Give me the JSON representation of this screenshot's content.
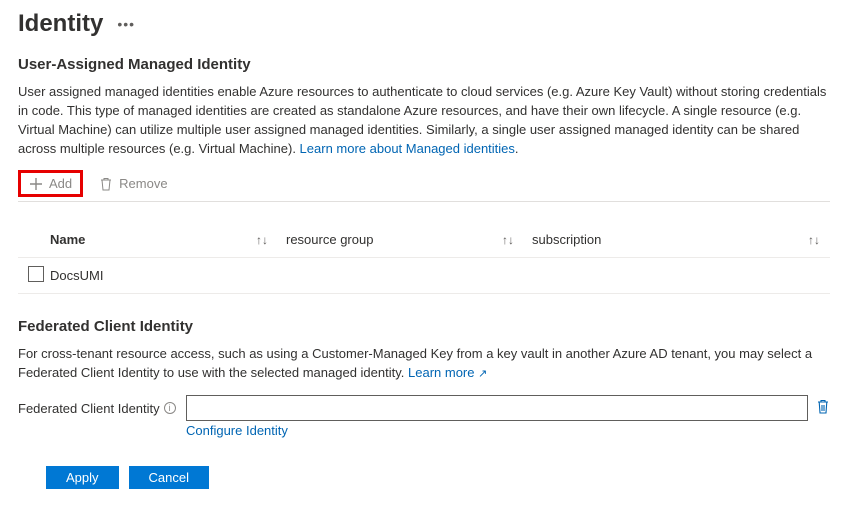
{
  "header": {
    "title": "Identity"
  },
  "section1": {
    "heading": "User-Assigned Managed Identity",
    "desc": "User assigned managed identities enable Azure resources to authenticate to cloud services (e.g. Azure Key Vault) without storing credentials in code. This type of managed identities are created as standalone Azure resources, and have their own lifecycle. A single resource (e.g. Virtual Machine) can utilize multiple user assigned managed identities. Similarly, a single user assigned managed identity can be shared across multiple resources (e.g. Virtual Machine). ",
    "learn_link": "Learn more about Managed identities",
    "add_label": "Add",
    "remove_label": "Remove"
  },
  "grid": {
    "cols": {
      "name": "Name",
      "rg": "resource group",
      "sub": "subscription"
    },
    "rows": [
      {
        "name": "DocsUMI",
        "rg": "",
        "sub": ""
      }
    ]
  },
  "section2": {
    "heading": "Federated Client Identity",
    "desc": "For cross-tenant resource access, such as using a Customer-Managed Key from a key vault in another Azure AD tenant, you may select a Federated Client Identity to use with the selected managed identity. ",
    "learn_link": "Learn more",
    "field_label": "Federated Client Identity",
    "field_value": "",
    "configure": "Configure Identity"
  },
  "buttons": {
    "apply": "Apply",
    "cancel": "Cancel"
  }
}
